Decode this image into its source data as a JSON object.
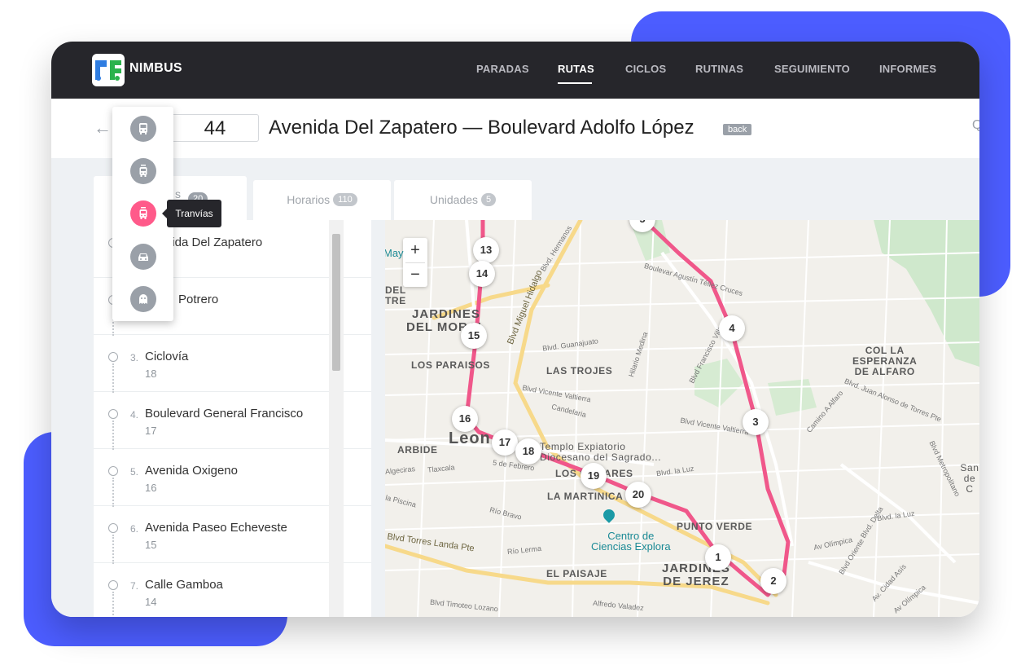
{
  "app": {
    "brand": "NIMBUS"
  },
  "nav": {
    "items": [
      {
        "label": "PARADAS"
      },
      {
        "label": "RUTAS"
      },
      {
        "label": "CICLOS"
      },
      {
        "label": "RUTINAS"
      },
      {
        "label": "SEGUIMIENTO"
      },
      {
        "label": "INFORMES"
      }
    ],
    "active": "RUTAS"
  },
  "route": {
    "number": "44",
    "title": "Avenida Del Zapatero — Boulevard Adolfo López",
    "badge": "back"
  },
  "tabs": {
    "first_label_visible": "s",
    "first_count": "20",
    "horarios_label": "Horarios",
    "horarios_count": "110",
    "unidades_label": "Unidades",
    "unidades_count": "5"
  },
  "stops": [
    {
      "index": "1.",
      "name": "Avenida Del Zapatero",
      "name_visible": "nida Del Zapatero",
      "count": ""
    },
    {
      "index": "2.",
      "name": "El Potrero",
      "name_visible": "Potrero",
      "count": ""
    },
    {
      "index": "3.",
      "name": "Ciclovía",
      "name_visible": "Ciclovía",
      "count": "18"
    },
    {
      "index": "4.",
      "name": "Boulevard General Francisco",
      "name_visible": "Boulevard General Francisco",
      "count": "17"
    },
    {
      "index": "5.",
      "name": "Avenida Oxigeno",
      "name_visible": "Avenida Oxigeno",
      "count": "16"
    },
    {
      "index": "6.",
      "name": "Avenida Paseo Echeveste",
      "name_visible": "Avenida Paseo Echeveste",
      "count": "15"
    },
    {
      "index": "7.",
      "name": "Calle Gamboa",
      "name_visible": "Calle Gamboa",
      "count": "14"
    }
  ],
  "vehicle_menu": {
    "items": [
      {
        "icon": "bus-icon"
      },
      {
        "icon": "trolleybus-icon"
      },
      {
        "icon": "tram-icon",
        "active": true
      },
      {
        "icon": "car-icon"
      },
      {
        "icon": "ghost-icon"
      }
    ],
    "tooltip": "Tranvías",
    "active_color": "#ff5a8a"
  },
  "map": {
    "zoom_in": "+",
    "zoom_out": "−",
    "route_color": "#f0578a",
    "markers": [
      "13",
      "14",
      "15",
      "16",
      "17",
      "18",
      "19",
      "20",
      "1",
      "2",
      "3",
      "4",
      "5"
    ],
    "places": {
      "jardines_del_moral": [
        "JARDINES",
        "DEL MORAL"
      ],
      "los_paraisos": "LOS PARAISOS",
      "las_trojes": "LAS TROJES",
      "col_la_esperanza": [
        "COL LA",
        "ESPERANZA",
        "DE ALFARO"
      ],
      "leon": "Leon",
      "arbide": "ARBIDE",
      "templo": [
        "Templo Expiatorio",
        "Diocesano del Sagrado..."
      ],
      "los_olivares": "LOS OLIVARES",
      "la_martinica": "LA MARTINICA",
      "punto_verde": "PUNTO VERDE",
      "centro_ciencias": [
        "Centro de",
        "Ciencias Explora"
      ],
      "jardines_de_jerez": [
        "JARDINES",
        "DE JEREZ"
      ],
      "el_paisaje": "EL PAISAJE",
      "del_tre": [
        "DEL",
        "TRE"
      ],
      "may": "May",
      "san_c": [
        "San",
        "de C"
      ]
    },
    "streets": {
      "blvd_miguel_hidalgo": "Blvd Miguel Hidalgo",
      "blvd_torres_landa": "Blvd Torres Landa Pte",
      "blvd_vicente_valtierra": "Blvd Vicente Valtierra",
      "blvd_guanajuato": "Blvd. Guanajuato",
      "candelaria": "Candelaria",
      "cinco_febrero": "5 de Febrero",
      "tlaxcala": "Tlaxcala",
      "rio_bravo": "Río Bravo",
      "rio_lerma": "Río Lerma",
      "blvd_la_luz": "Blvd. la Luz",
      "blvd_la_luz_2": "Blvd. la Luz",
      "av_olimpica": "Av Olímpica",
      "blvd_delta": "Blvd. Delta",
      "blvd_hermanos": "Blvd. Hermanos",
      "blvd_agustin_tellez": "Boulevar Agustín Téllez Cruces",
      "blvd_francisco_villa": "Blvd Francisco Villa",
      "camino_alfaro": "Camino A Alfaro",
      "blvd_juan_alonso": "Blvd. Juan Alonso de Torres Pte",
      "blvd_metropolitano": "Blvd Metropolitano",
      "blvd_timoteo": "Blvd Timoteo Lozano",
      "alfredo_valadez": "Alfredo Valadez",
      "hilario_medina": "Hilario Medina",
      "algeciras": "Algeciras",
      "la_piscina": "la Piscina",
      "calle_oriente": "Blvd Oriente",
      "av_cidad_asis": "Av. Cidad Asís",
      "av_olimpica_2": "Av Olímpica"
    }
  }
}
